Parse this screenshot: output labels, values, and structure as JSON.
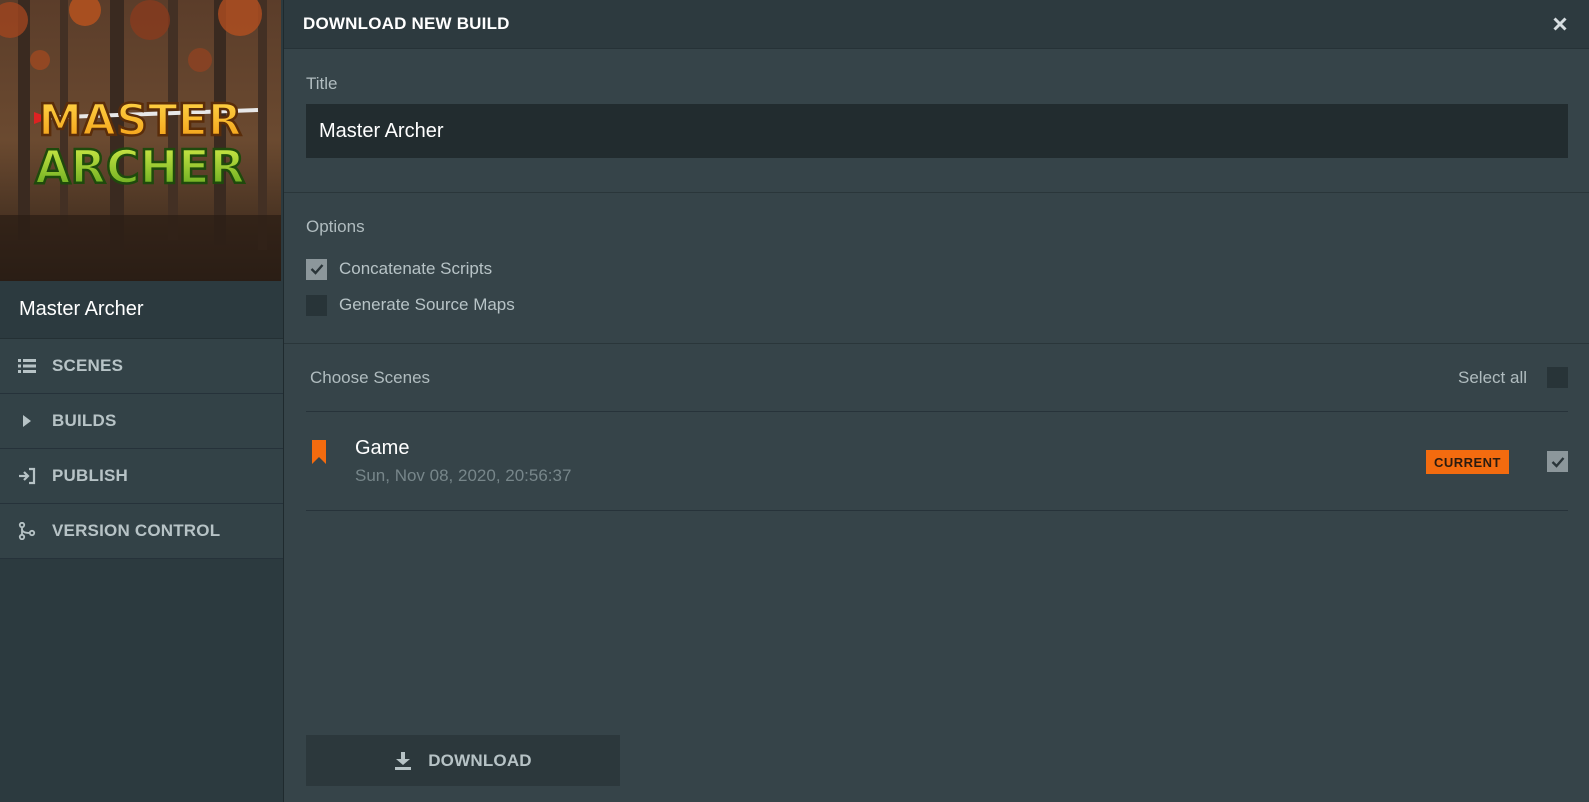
{
  "project": {
    "logo_line1": "MASTER",
    "logo_line2": "ARCHER",
    "name": "Master Archer"
  },
  "sidebar": {
    "items": [
      {
        "label": "SCENES",
        "icon": "list-icon"
      },
      {
        "label": "BUILDS",
        "icon": "play-icon"
      },
      {
        "label": "PUBLISH",
        "icon": "publish-icon"
      },
      {
        "label": "VERSION CONTROL",
        "icon": "branch-icon"
      }
    ]
  },
  "dialog": {
    "title": "DOWNLOAD NEW BUILD",
    "close_icon": "close-icon"
  },
  "title_section": {
    "label": "Title",
    "value": "Master Archer"
  },
  "options": {
    "label": "Options",
    "items": [
      {
        "label": "Concatenate Scripts",
        "checked": true
      },
      {
        "label": "Generate Source Maps",
        "checked": false
      }
    ]
  },
  "scenes": {
    "label": "Choose Scenes",
    "select_all_label": "Select all",
    "select_all_checked": false,
    "list": [
      {
        "name": "Game",
        "modified": "Sun, Nov 08, 2020, 20:56:37",
        "badge": "CURRENT",
        "checked": true
      }
    ]
  },
  "download": {
    "label": "DOWNLOAD",
    "icon": "download-icon"
  },
  "colors": {
    "accent": "#f36b0f",
    "panel": "#364449",
    "sidebar": "#2c3a3f"
  }
}
